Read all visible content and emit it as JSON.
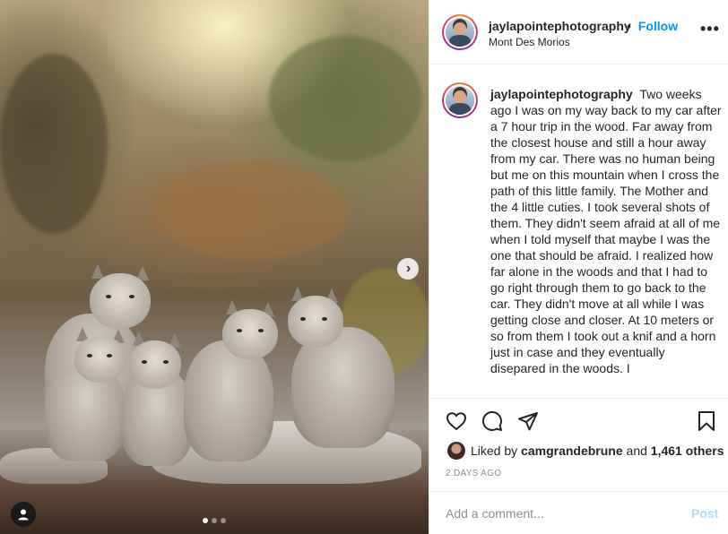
{
  "post": {
    "username": "jaylapointephotography",
    "follow_separator": "•",
    "follow_label": "Follow",
    "location": "Mont Des Morios",
    "more_label": "•••",
    "caption": "Two weeks ago I was on my way back to my car after a 7 hour trip in the wood. Far away from the closest house and still a hour away from my car. There was no human being but me on this mountain when I cross the path of this little family. The Mother and the 4 little cuties. I took several shots of them. They didn't seem afraid at all of me when I told myself that maybe I was the one that should be afraid. I realized how far alone in the woods and that I had to go right through them to go back to the car. They didn't move at all while I was getting close and closer. At 10 meters or so from them I took out a knif and a horn just in case and they eventually disepared in the woods. I",
    "likes": {
      "prefix": "Liked by",
      "user": "camgrandebrune",
      "joiner": "and",
      "others": "1,461 others"
    },
    "timestamp": "2 DAYS AGO"
  },
  "comment": {
    "placeholder": "Add a comment...",
    "post_label": "Post"
  },
  "carousel": {
    "next_label": "›",
    "slide_count": 3,
    "active_slide": 1
  },
  "icons": {
    "like": "heart-icon",
    "comment": "comment-icon",
    "share": "paper-plane-icon",
    "save": "bookmark-icon",
    "tag": "user-tag-icon"
  },
  "colors": {
    "accent": "#0095f6",
    "post_disabled": "#b3dbff",
    "muted": "#8e8e8e",
    "text": "#262626"
  }
}
